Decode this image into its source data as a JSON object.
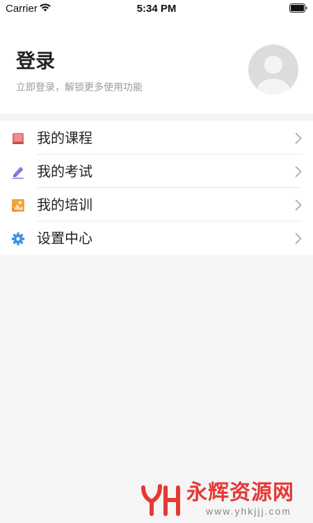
{
  "status_bar": {
    "carrier": "Carrier",
    "time": "5:34 PM",
    "wifi_icon": "wifi-icon",
    "battery_icon": "battery-icon"
  },
  "header": {
    "title": "登录",
    "subtitle": "立即登录，解锁更多使用功能",
    "avatar_icon": "default-avatar-icon"
  },
  "menu": {
    "items": [
      {
        "label": "我的课程",
        "icon": "book-icon",
        "color": "#e5696b"
      },
      {
        "label": "我的考试",
        "icon": "pencil-icon",
        "color": "#8a76e0"
      },
      {
        "label": "我的培训",
        "icon": "training-icon",
        "color": "#f0a33a"
      },
      {
        "label": "设置中心",
        "icon": "gear-icon",
        "color": "#3a8fe8"
      }
    ],
    "chevron_icon": "chevron-right-icon"
  },
  "watermark": {
    "text": "永辉资源网",
    "url": "www.yhkjjj.com",
    "color": "#e53935"
  }
}
